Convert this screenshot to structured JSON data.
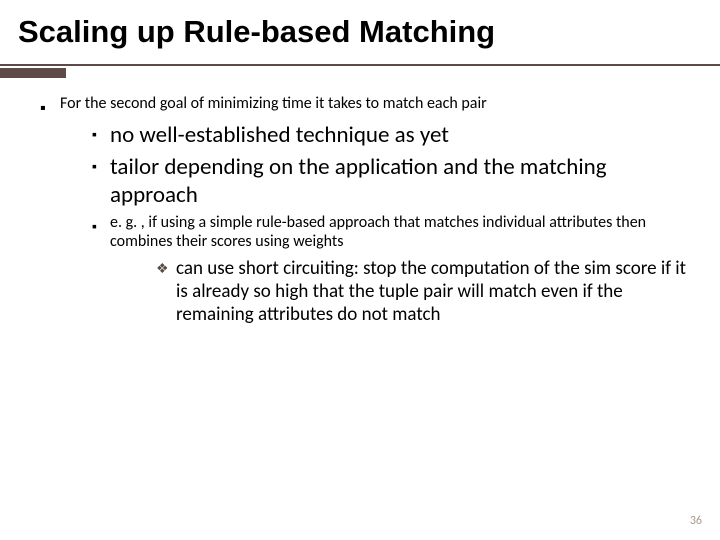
{
  "title": "Scaling up Rule-based Matching",
  "bullets": {
    "l1_0": "For the second goal of minimizing time it takes to match each pair",
    "l2_0": "no well-established technique as yet",
    "l2_1": "tailor depending on the application and the matching approach",
    "l2_2": "e. g. , if using a simple rule-based approach that matches individual attributes then combines their scores using weights",
    "l3_0": "can use short circuiting: stop the computation of the sim score if it is already so high that the tuple pair will match even if the remaining attributes do not match"
  },
  "glyphs": {
    "square": "▪",
    "diamond": "❖"
  },
  "pagenum": "36"
}
